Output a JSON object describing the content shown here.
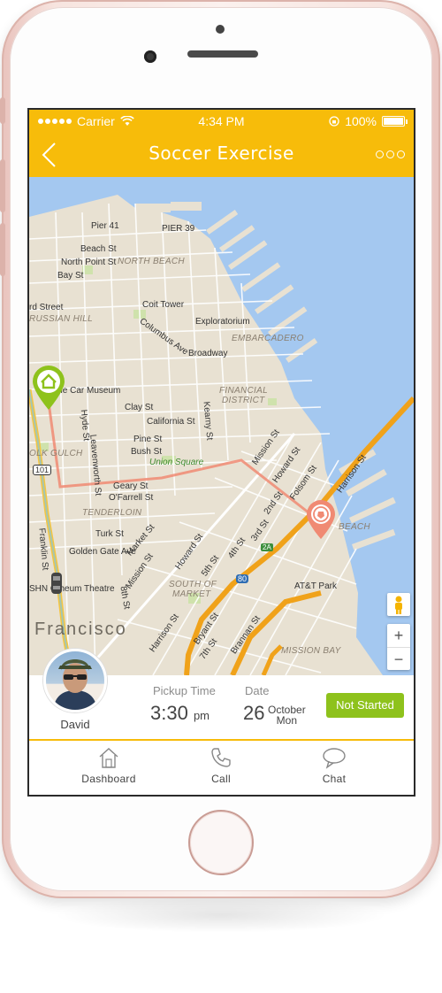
{
  "status_bar": {
    "carrier": "Carrier",
    "time": "4:34 PM",
    "battery": "100%"
  },
  "header": {
    "title": "Soccer Exercise",
    "back_icon": "chevron-left-icon",
    "more_icon": "more-dots-icon"
  },
  "map": {
    "labels": {
      "pier41": "Pier 41",
      "pier39": "PIER 39",
      "beach_st": "Beach St",
      "north_point_st": "North Point St",
      "bay_st": "Bay St",
      "north_beach": "NORTH BEACH",
      "coit_tower": "Coit Tower",
      "lombard": "rd Street",
      "russian_hill": "RUSSIAN HILL",
      "exploratorium": "Exploratorium",
      "columbus": "Columbus Ave",
      "embarcadero": "EMBARCADERO",
      "broadway": "Broadway",
      "cable_car": "ble Car Museum",
      "financial": "FINANCIAL",
      "district": "DISTRICT",
      "clay_st": "Clay St",
      "hyde_st": "Hyde St",
      "california_st": "California St",
      "kearny_st": "Kearny St",
      "pine_st": "Pine St",
      "bush_st": "Bush St",
      "mission_st_n": "Mission St",
      "howard_st_n": "Howard St",
      "folsom_st": "Folsom St",
      "harrison_st_e": "Harrison St",
      "union_square": "Union Square",
      "leavenworth": "Leavenworth St",
      "polk_gulch": "OLK GULCH",
      "geary": "Geary St",
      "ofarrell": "O'Farrell St",
      "second_st": "2nd St",
      "beach_label": "BEACH",
      "tenderloin": "TENDERLOIN",
      "turk": "Turk St",
      "golden_gate": "Golden Gate Ave",
      "market": "Market St",
      "mission_st_s": "Mission St",
      "howard_st_s": "Howard St",
      "fifth_st": "5th St",
      "fourth_st": "4th St",
      "third_st": "3rd St",
      "franklin": "Franklin St",
      "south_of": "SOUTH OF",
      "market_area": "MARKET",
      "att_park": "AT&T Park",
      "theatre": "SHN O    heum Theatre",
      "eighth_st": "8th St",
      "francisco": "Francisco",
      "harrison_s": "Harrison St",
      "bryant": "Bryant St",
      "seventh": "7th St",
      "brannan": "Brannan St",
      "mission_bay": "MISSION BAY",
      "hwy101": "101",
      "hwy80": "80",
      "hwy2a": "2A"
    },
    "markers": {
      "origin_icon": "home-pin-icon",
      "destination_icon": "soccer-ball-pin-icon"
    },
    "zoom_in": "+",
    "zoom_out": "−"
  },
  "trip": {
    "driver_name": "David",
    "pickup_label": "Pickup Time",
    "pickup_time": "3:30",
    "pickup_period": "pm",
    "date_label": "Date",
    "date_day": "26",
    "date_month": "October",
    "date_weekday": "Mon",
    "status": "Not Started",
    "status_color": "#8ec21c"
  },
  "tabs": [
    {
      "label": "Dashboard",
      "icon": "house-icon"
    },
    {
      "label": "Call",
      "icon": "phone-icon"
    },
    {
      "label": "Chat",
      "icon": "chat-bubble-icon"
    }
  ],
  "colors": {
    "accent": "#f7bc0a",
    "route": "#f08a73",
    "water": "#a4c8f0",
    "land": "#e8e1d2"
  }
}
